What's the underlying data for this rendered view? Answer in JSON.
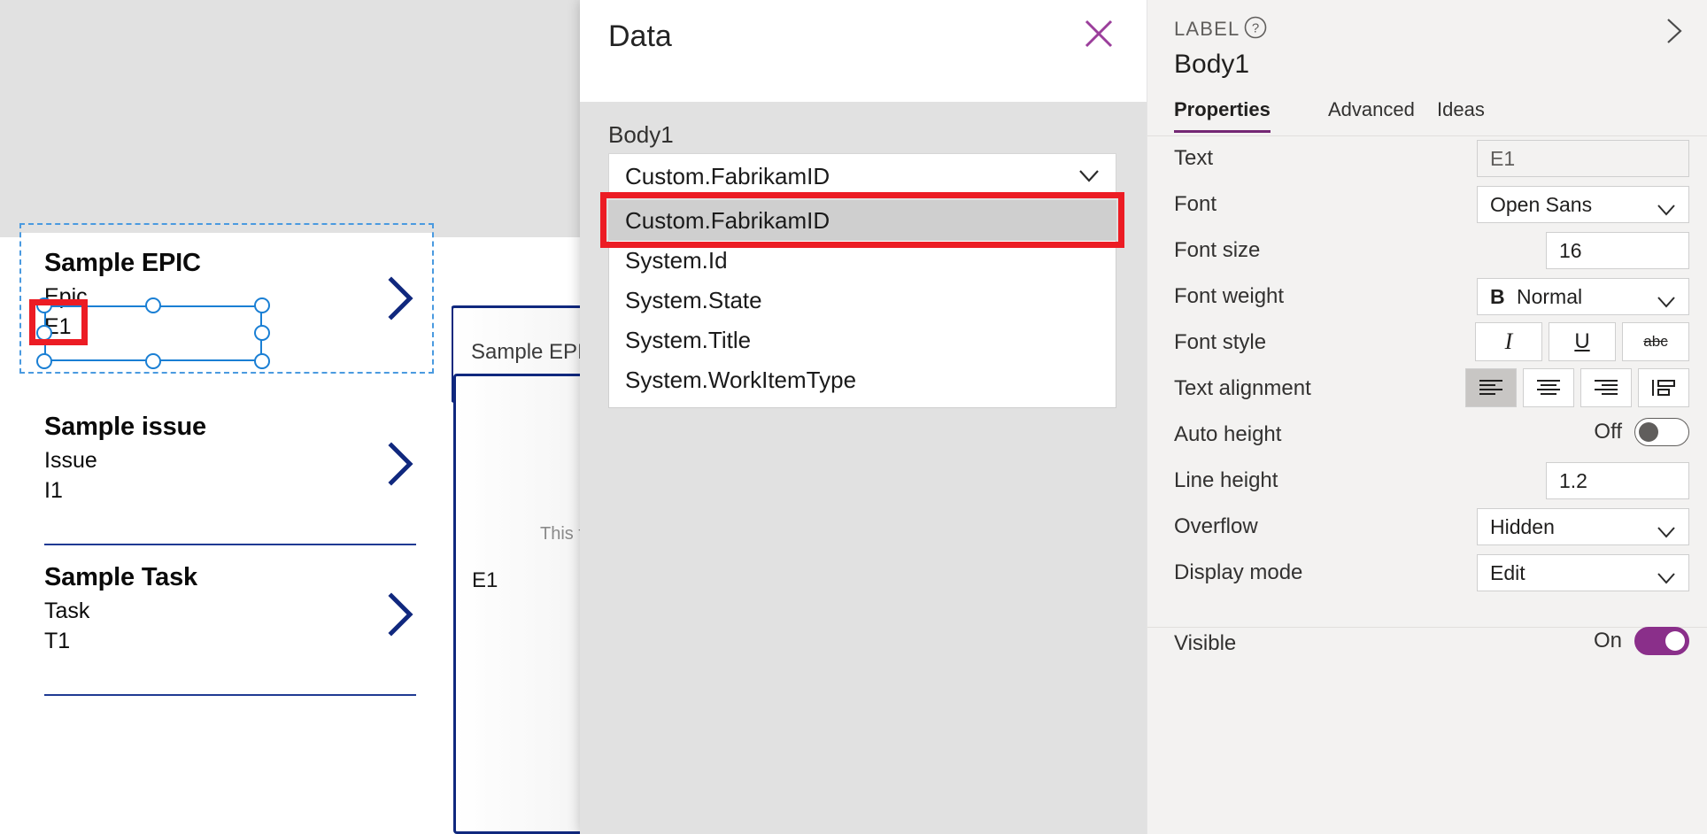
{
  "canvas": {
    "gallery": [
      {
        "title": "Sample EPIC",
        "type": "Epic",
        "id": "E1",
        "chevron": "chevron-right-icon"
      },
      {
        "title": "Sample issue",
        "type": "Issue",
        "id": "I1",
        "chevron": "chevron-right-icon"
      },
      {
        "title": "Sample Task",
        "type": "Task",
        "id": "T1",
        "chevron": "chevron-right-icon"
      }
    ],
    "preview": {
      "epic_box_label": "Sample EPIC",
      "hint_text": "This fo",
      "detail_id": "E1"
    },
    "selection": {
      "selected_control": "Body1",
      "handle_color": "#1a7fd4",
      "outline_color": "#4a9ae0",
      "annotation_color": "#ec1c24"
    }
  },
  "data_panel": {
    "title": "Data",
    "close_icon": "close-icon",
    "field_label": "Body1",
    "combo_value": "Custom.FabrikamID",
    "caret_icon": "chevron-down-icon",
    "options": [
      "Custom.FabrikamID",
      "System.Id",
      "System.State",
      "System.Title",
      "System.WorkItemType"
    ],
    "selected_option_index": 0
  },
  "properties_panel": {
    "kicker": "LABEL",
    "help_icon": "help-circle-icon",
    "collapse_icon": "chevron-right-icon",
    "control_name": "Body1",
    "accent_color": "#742774",
    "tabs": [
      {
        "label": "Properties",
        "active": true
      },
      {
        "label": "Advanced",
        "active": false
      },
      {
        "label": "Ideas",
        "active": false
      }
    ],
    "rows": {
      "text": {
        "label": "Text",
        "value": "E1"
      },
      "font": {
        "label": "Font",
        "value": "Open Sans"
      },
      "font_size": {
        "label": "Font size",
        "value": "16"
      },
      "font_weight": {
        "label": "Font weight",
        "value": "Normal",
        "prefix": "B"
      },
      "font_style": {
        "label": "Font style",
        "options": [
          "italic-icon",
          "underline-icon",
          "strikethrough-icon"
        ]
      },
      "text_alignment": {
        "label": "Text alignment",
        "options": [
          "align-left-icon",
          "align-center-icon",
          "align-right-icon",
          "align-justify-icon"
        ],
        "selected_index": 0
      },
      "auto_height": {
        "label": "Auto height",
        "state": "Off",
        "on": false
      },
      "line_height": {
        "label": "Line height",
        "value": "1.2"
      },
      "overflow": {
        "label": "Overflow",
        "value": "Hidden"
      },
      "display_mode": {
        "label": "Display mode",
        "value": "Edit"
      },
      "visible": {
        "label": "Visible",
        "state": "On",
        "on": true
      }
    }
  }
}
